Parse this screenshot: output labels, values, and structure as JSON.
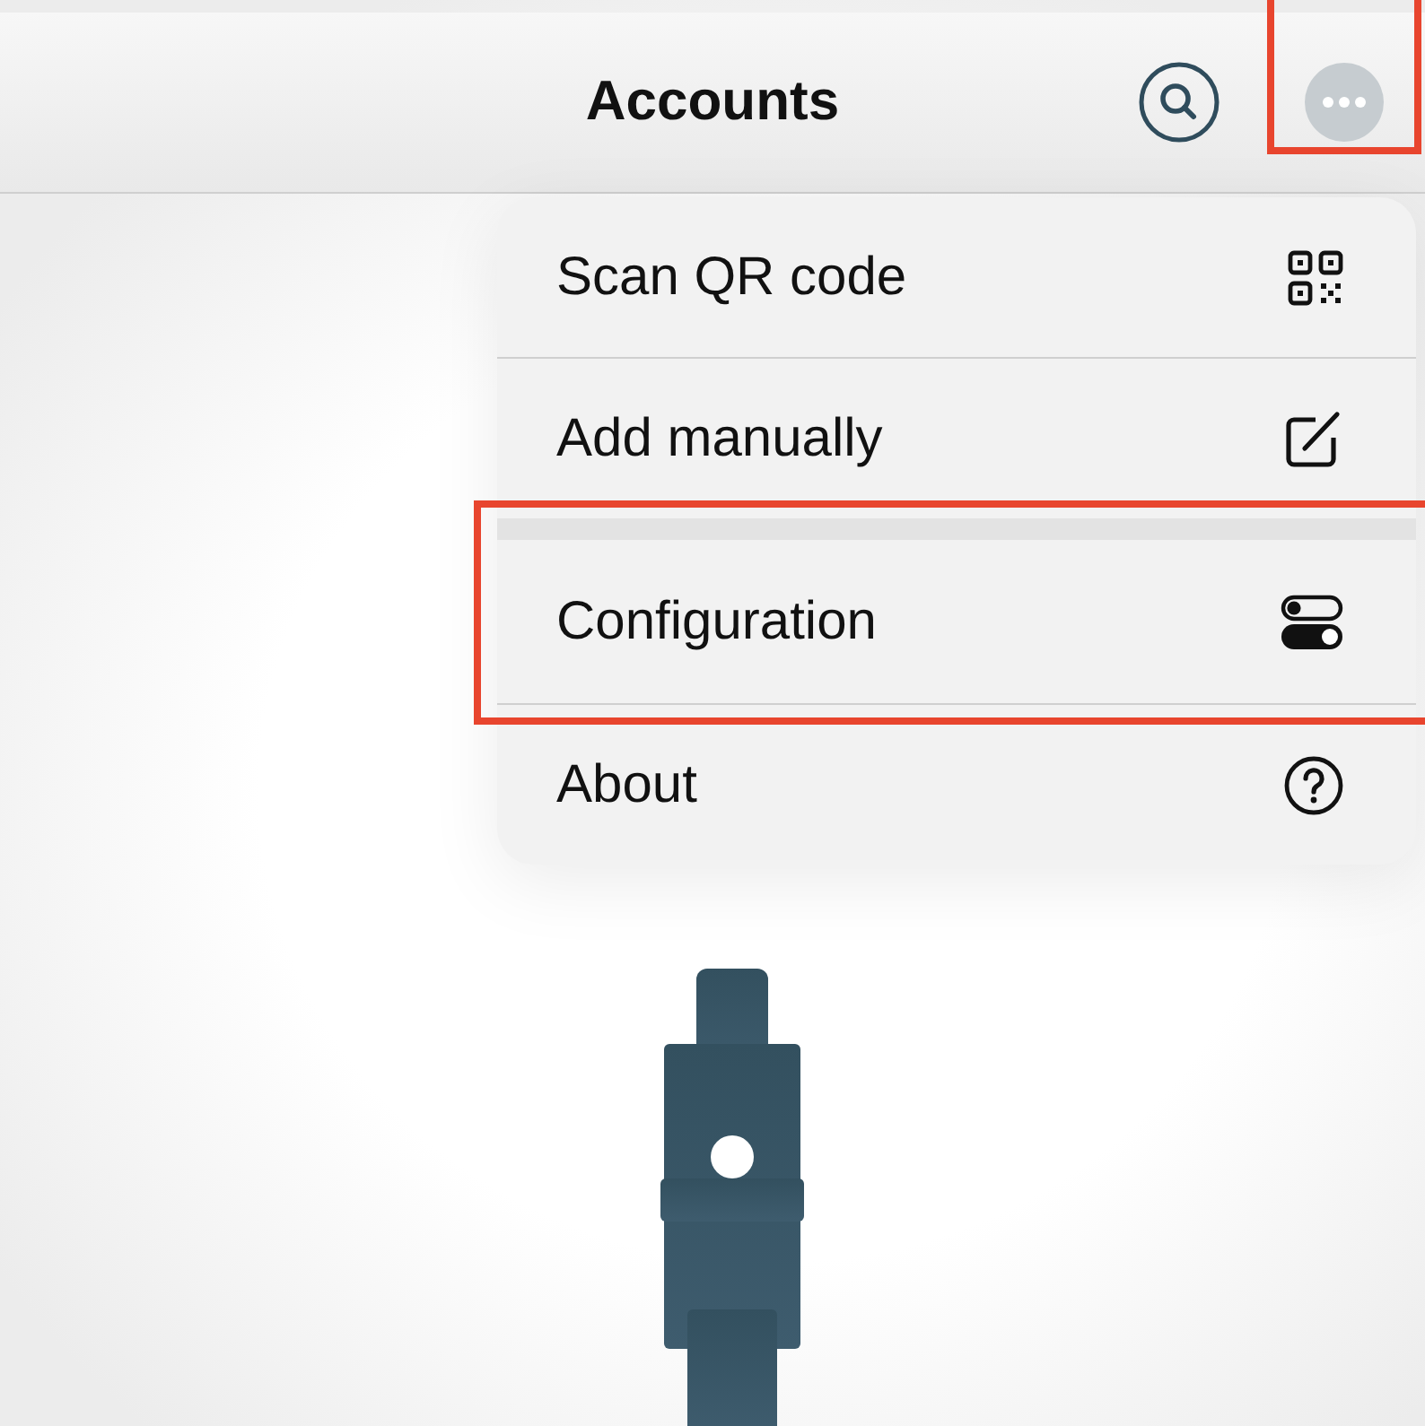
{
  "header": {
    "title": "Accounts",
    "more_highlighted": true
  },
  "menu": {
    "items": [
      {
        "label": "Scan QR code",
        "kind": "qr",
        "highlighted": false
      },
      {
        "label": "Add manually",
        "kind": "edit",
        "highlighted": false
      },
      {
        "label": "Configuration",
        "kind": "toggles",
        "highlighted": true
      },
      {
        "label": "About",
        "kind": "help",
        "highlighted": false
      }
    ]
  }
}
